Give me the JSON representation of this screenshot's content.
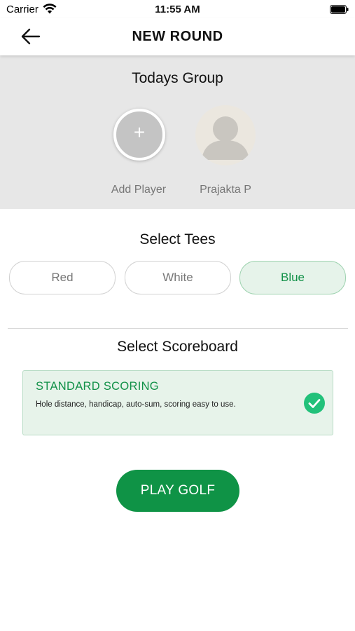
{
  "status_bar": {
    "carrier": "Carrier",
    "time": "11:55 AM"
  },
  "nav": {
    "title": "NEW ROUND",
    "back_icon": "arrow-left-icon"
  },
  "group": {
    "title": "Todays Group",
    "add_player": {
      "icon": "plus",
      "label": "Add Player"
    },
    "players": [
      {
        "name": "Prajakta P",
        "avatar": "person-placeholder-icon"
      }
    ]
  },
  "tees": {
    "title": "Select Tees",
    "options": [
      "Red",
      "White",
      "Blue"
    ],
    "selected": "Blue"
  },
  "scoreboard": {
    "title": "Select Scoreboard",
    "option": {
      "name": "STANDARD SCORING",
      "description": "Hole distance, handicap, auto-sum, scoring easy to use.",
      "selected": true
    }
  },
  "play_button": {
    "label": "PLAY GOLF"
  },
  "colors": {
    "accent": "#0f9346",
    "selected_bg": "#e6f3ea",
    "group_bg": "#e7e7e7"
  }
}
